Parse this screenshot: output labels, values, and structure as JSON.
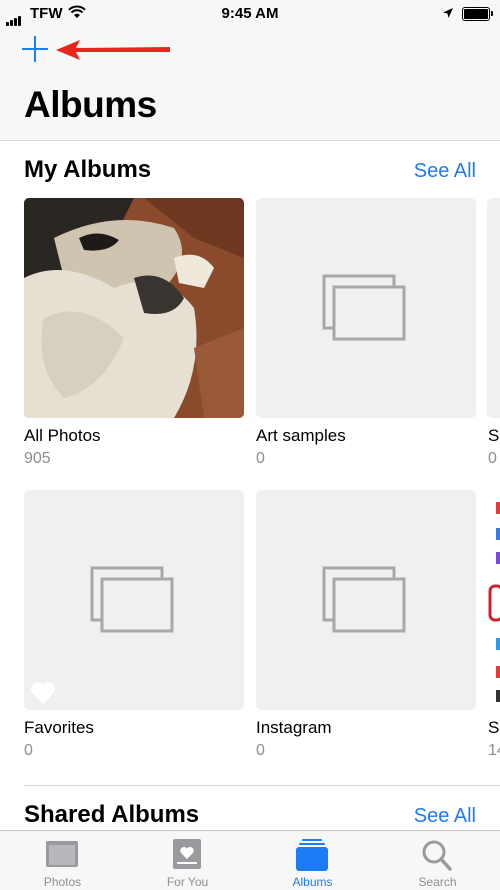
{
  "status_bar": {
    "carrier": "TFW",
    "time": "9:45 AM"
  },
  "nav": {
    "title": "Albums",
    "add_icon": "plus-icon",
    "annotation_color": "#e8261c"
  },
  "my_albums": {
    "title": "My Albums",
    "see_all": "See All",
    "albums": [
      {
        "name": "All Photos",
        "count": "905"
      },
      {
        "name": "Art samples",
        "count": "0"
      },
      {
        "name": "Favorites",
        "count": "0"
      },
      {
        "name": "Instagram",
        "count": "0"
      }
    ],
    "peek": [
      {
        "name": "S",
        "count": "0"
      },
      {
        "name": "S",
        "count": "14"
      }
    ]
  },
  "shared_albums": {
    "title": "Shared Albums",
    "see_all": "See All"
  },
  "tab_bar": {
    "tabs": [
      {
        "label": "Photos",
        "icon": "photos-icon"
      },
      {
        "label": "For You",
        "icon": "for-you-icon"
      },
      {
        "label": "Albums",
        "icon": "albums-icon",
        "active": true
      },
      {
        "label": "Search",
        "icon": "search-icon"
      }
    ]
  },
  "colors": {
    "accent": "#1c7cf4",
    "secondary_text": "#8e8e93",
    "placeholder_bg": "#f0f0f0"
  }
}
